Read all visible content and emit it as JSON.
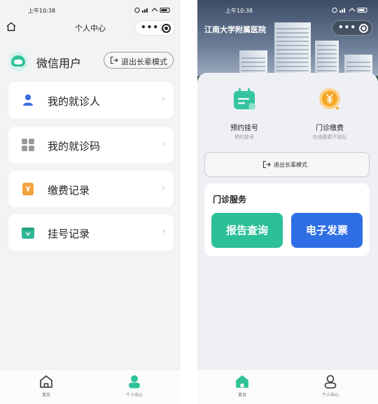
{
  "left": {
    "status": {
      "time": "上午10:38",
      "extra": "···"
    },
    "nav_title": "个人中心",
    "user_name": "微信用户",
    "exit_label": "退出长辈模式",
    "menu": [
      {
        "label": "我的就诊人",
        "icon": "patient-icon",
        "color": "#3b6fe0"
      },
      {
        "label": "我的就诊码",
        "icon": "grid-icon",
        "color": "#9a9a9a"
      },
      {
        "label": "缴费记录",
        "icon": "payment-record-icon",
        "color": "#f2a23c"
      },
      {
        "label": "挂号记录",
        "icon": "registration-record-icon",
        "color": "#2fb796"
      }
    ],
    "tabs": [
      {
        "label": "首页",
        "icon": "home-outline-icon"
      },
      {
        "label": "个人中心",
        "icon": "person-filled-icon"
      }
    ]
  },
  "right": {
    "status": {
      "time": "上午10:38",
      "extra": "···"
    },
    "hospital_name": "江南大学附属医院",
    "quick": [
      {
        "title": "预约挂号",
        "subtitle": "预约挂号",
        "icon": "calendar-icon",
        "color": "#35c3a0"
      },
      {
        "title": "门诊缴费",
        "subtitle": "在线缴费不排队",
        "icon": "yuan-coin-icon",
        "color": "#f5a623"
      }
    ],
    "exit_label": "退出长辈模式",
    "service_title": "门诊服务",
    "services": [
      {
        "label": "报告查询",
        "color": "#2dbf98"
      },
      {
        "label": "电子发票",
        "color": "#2f6fe6"
      }
    ],
    "tabs": [
      {
        "label": "首页",
        "icon": "home-filled-icon"
      },
      {
        "label": "个人中心",
        "icon": "person-outline-icon"
      }
    ]
  },
  "colors": {
    "accent_green": "#2fc197",
    "accent_blue": "#2f6fe6",
    "background": "#f2f3f5"
  }
}
